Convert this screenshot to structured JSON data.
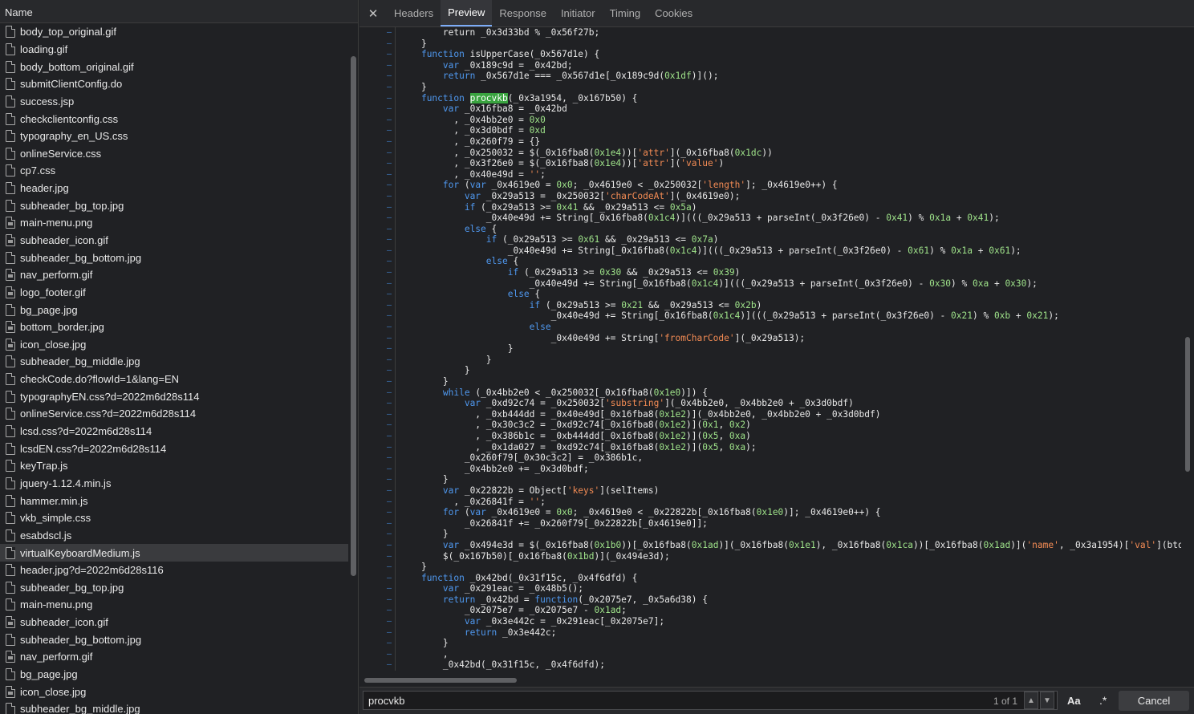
{
  "left_panel": {
    "header": "Name",
    "files": [
      {
        "name": "body_top_original.gif",
        "icon": "file-icon"
      },
      {
        "name": "loading.gif",
        "icon": "file-icon"
      },
      {
        "name": "body_bottom_original.gif",
        "icon": "file-icon"
      },
      {
        "name": "submitClientConfig.do",
        "icon": "file-icon"
      },
      {
        "name": "success.jsp",
        "icon": "file-icon"
      },
      {
        "name": "checkclientconfig.css",
        "icon": "file-icon"
      },
      {
        "name": "typography_en_US.css",
        "icon": "file-icon"
      },
      {
        "name": "onlineService.css",
        "icon": "file-icon"
      },
      {
        "name": "cp7.css",
        "icon": "file-icon"
      },
      {
        "name": "header.jpg",
        "icon": "file-icon"
      },
      {
        "name": "subheader_bg_top.jpg",
        "icon": "file-icon"
      },
      {
        "name": "main-menu.png",
        "icon": "image-icon"
      },
      {
        "name": "subheader_icon.gif",
        "icon": "image-icon"
      },
      {
        "name": "subheader_bg_bottom.jpg",
        "icon": "file-icon"
      },
      {
        "name": "nav_perform.gif",
        "icon": "image-icon"
      },
      {
        "name": "logo_footer.gif",
        "icon": "image-icon"
      },
      {
        "name": "bg_page.jpg",
        "icon": "file-icon"
      },
      {
        "name": "bottom_border.jpg",
        "icon": "image-icon"
      },
      {
        "name": "icon_close.jpg",
        "icon": "image-icon"
      },
      {
        "name": "subheader_bg_middle.jpg",
        "icon": "file-icon"
      },
      {
        "name": "checkCode.do?flowId=1&lang=EN",
        "icon": "file-icon"
      },
      {
        "name": "typographyEN.css?d=2022m6d28s114",
        "icon": "file-icon"
      },
      {
        "name": "onlineService.css?d=2022m6d28s114",
        "icon": "file-icon"
      },
      {
        "name": "lcsd.css?d=2022m6d28s114",
        "icon": "file-icon"
      },
      {
        "name": "lcsdEN.css?d=2022m6d28s114",
        "icon": "file-icon"
      },
      {
        "name": "keyTrap.js",
        "icon": "file-icon"
      },
      {
        "name": "jquery-1.12.4.min.js",
        "icon": "file-icon"
      },
      {
        "name": "hammer.min.js",
        "icon": "file-icon"
      },
      {
        "name": "vkb_simple.css",
        "icon": "file-icon"
      },
      {
        "name": "esabdscl.js",
        "icon": "file-icon"
      },
      {
        "name": "virtualKeyboardMedium.js",
        "icon": "file-icon",
        "selected": true
      },
      {
        "name": "header.jpg?d=2022m6d28s116",
        "icon": "file-icon"
      },
      {
        "name": "subheader_bg_top.jpg",
        "icon": "file-icon"
      },
      {
        "name": "main-menu.png",
        "icon": "file-icon"
      },
      {
        "name": "subheader_icon.gif",
        "icon": "image-icon"
      },
      {
        "name": "subheader_bg_bottom.jpg",
        "icon": "file-icon"
      },
      {
        "name": "nav_perform.gif",
        "icon": "image-icon"
      },
      {
        "name": "bg_page.jpg",
        "icon": "file-icon"
      },
      {
        "name": "icon_close.jpg",
        "icon": "image-icon"
      },
      {
        "name": "subheader_bg_middle.jpg",
        "icon": "file-icon"
      }
    ]
  },
  "tabs": [
    "Headers",
    "Preview",
    "Response",
    "Initiator",
    "Timing",
    "Cookies"
  ],
  "active_tab": "Preview",
  "code_lines": [
    [
      {
        "t": "        return _0x3d33bd % _0x56f27b;"
      }
    ],
    [
      {
        "t": "    }"
      }
    ],
    [
      {
        "t": "    "
      },
      {
        "t": "function",
        "c": "k"
      },
      {
        "t": " isUpperCase(_0x567d1e) {"
      }
    ],
    [
      {
        "t": "        "
      },
      {
        "t": "var",
        "c": "k"
      },
      {
        "t": " _0x189c9d = _0x42bd;"
      }
    ],
    [
      {
        "t": "        "
      },
      {
        "t": "return",
        "c": "k"
      },
      {
        "t": " _0x567d1e === _0x567d1e[_0x189c9d("
      },
      {
        "t": "0x1df",
        "c": "n"
      },
      {
        "t": ")]();"
      }
    ],
    [
      {
        "t": "    }"
      }
    ],
    [
      {
        "t": "    "
      },
      {
        "t": "function",
        "c": "k"
      },
      {
        "t": " "
      },
      {
        "t": "procvkb",
        "c": "hl"
      },
      {
        "t": "(_0x3a1954, _0x167b50) {"
      }
    ],
    [
      {
        "t": "        "
      },
      {
        "t": "var",
        "c": "k"
      },
      {
        "t": " _0x16fba8 = _0x42bd"
      }
    ],
    [
      {
        "t": "          , _0x4bb2e0 = "
      },
      {
        "t": "0x0",
        "c": "n"
      }
    ],
    [
      {
        "t": "          , _0x3d0bdf = "
      },
      {
        "t": "0xd",
        "c": "n"
      }
    ],
    [
      {
        "t": "          , _0x260f79 = {}"
      }
    ],
    [
      {
        "t": "          , _0x250032 = $(_0x16fba8("
      },
      {
        "t": "0x1e4",
        "c": "n"
      },
      {
        "t": "))["
      },
      {
        "t": "'attr'",
        "c": "s"
      },
      {
        "t": "](_0x16fba8("
      },
      {
        "t": "0x1dc",
        "c": "n"
      },
      {
        "t": "))"
      }
    ],
    [
      {
        "t": "          , _0x3f26e0 = $(_0x16fba8("
      },
      {
        "t": "0x1e4",
        "c": "n"
      },
      {
        "t": "))["
      },
      {
        "t": "'attr'",
        "c": "s"
      },
      {
        "t": "]("
      },
      {
        "t": "'value'",
        "c": "s"
      },
      {
        "t": ")"
      }
    ],
    [
      {
        "t": "          , _0x40e49d = "
      },
      {
        "t": "''",
        "c": "s"
      },
      {
        "t": ";"
      }
    ],
    [
      {
        "t": "        "
      },
      {
        "t": "for",
        "c": "k"
      },
      {
        "t": " ("
      },
      {
        "t": "var",
        "c": "k"
      },
      {
        "t": " _0x4619e0 = "
      },
      {
        "t": "0x0",
        "c": "n"
      },
      {
        "t": "; _0x4619e0 < _0x250032["
      },
      {
        "t": "'length'",
        "c": "s"
      },
      {
        "t": "]; _0x4619e0++) {"
      }
    ],
    [
      {
        "t": "            "
      },
      {
        "t": "var",
        "c": "k"
      },
      {
        "t": " _0x29a513 = _0x250032["
      },
      {
        "t": "'charCodeAt'",
        "c": "s"
      },
      {
        "t": "](_0x4619e0);"
      }
    ],
    [
      {
        "t": "            "
      },
      {
        "t": "if",
        "c": "k"
      },
      {
        "t": " (_0x29a513 >= "
      },
      {
        "t": "0x41",
        "c": "n"
      },
      {
        "t": " && _0x29a513 <= "
      },
      {
        "t": "0x5a",
        "c": "n"
      },
      {
        "t": ")"
      }
    ],
    [
      {
        "t": "                _0x40e49d += String[_0x16fba8("
      },
      {
        "t": "0x1c4",
        "c": "n"
      },
      {
        "t": ")](((_0x29a513 + parseInt(_0x3f26e0) - "
      },
      {
        "t": "0x41",
        "c": "n"
      },
      {
        "t": ") % "
      },
      {
        "t": "0x1a",
        "c": "n"
      },
      {
        "t": " + "
      },
      {
        "t": "0x41",
        "c": "n"
      },
      {
        "t": ");"
      }
    ],
    [
      {
        "t": "            "
      },
      {
        "t": "else",
        "c": "k"
      },
      {
        "t": " {"
      }
    ],
    [
      {
        "t": "                "
      },
      {
        "t": "if",
        "c": "k"
      },
      {
        "t": " (_0x29a513 >= "
      },
      {
        "t": "0x61",
        "c": "n"
      },
      {
        "t": " && _0x29a513 <= "
      },
      {
        "t": "0x7a",
        "c": "n"
      },
      {
        "t": ")"
      }
    ],
    [
      {
        "t": "                    _0x40e49d += String[_0x16fba8("
      },
      {
        "t": "0x1c4",
        "c": "n"
      },
      {
        "t": ")](((_0x29a513 + parseInt(_0x3f26e0) - "
      },
      {
        "t": "0x61",
        "c": "n"
      },
      {
        "t": ") % "
      },
      {
        "t": "0x1a",
        "c": "n"
      },
      {
        "t": " + "
      },
      {
        "t": "0x61",
        "c": "n"
      },
      {
        "t": ");"
      }
    ],
    [
      {
        "t": "                "
      },
      {
        "t": "else",
        "c": "k"
      },
      {
        "t": " {"
      }
    ],
    [
      {
        "t": "                    "
      },
      {
        "t": "if",
        "c": "k"
      },
      {
        "t": " (_0x29a513 >= "
      },
      {
        "t": "0x30",
        "c": "n"
      },
      {
        "t": " && _0x29a513 <= "
      },
      {
        "t": "0x39",
        "c": "n"
      },
      {
        "t": ")"
      }
    ],
    [
      {
        "t": "                        _0x40e49d += String[_0x16fba8("
      },
      {
        "t": "0x1c4",
        "c": "n"
      },
      {
        "t": ")](((_0x29a513 + parseInt(_0x3f26e0) - "
      },
      {
        "t": "0x30",
        "c": "n"
      },
      {
        "t": ") % "
      },
      {
        "t": "0xa",
        "c": "n"
      },
      {
        "t": " + "
      },
      {
        "t": "0x30",
        "c": "n"
      },
      {
        "t": ");"
      }
    ],
    [
      {
        "t": "                    "
      },
      {
        "t": "else",
        "c": "k"
      },
      {
        "t": " {"
      }
    ],
    [
      {
        "t": "                        "
      },
      {
        "t": "if",
        "c": "k"
      },
      {
        "t": " (_0x29a513 >= "
      },
      {
        "t": "0x21",
        "c": "n"
      },
      {
        "t": " && _0x29a513 <= "
      },
      {
        "t": "0x2b",
        "c": "n"
      },
      {
        "t": ")"
      }
    ],
    [
      {
        "t": "                            _0x40e49d += String[_0x16fba8("
      },
      {
        "t": "0x1c4",
        "c": "n"
      },
      {
        "t": ")](((_0x29a513 + parseInt(_0x3f26e0) - "
      },
      {
        "t": "0x21",
        "c": "n"
      },
      {
        "t": ") % "
      },
      {
        "t": "0xb",
        "c": "n"
      },
      {
        "t": " + "
      },
      {
        "t": "0x21",
        "c": "n"
      },
      {
        "t": ");"
      }
    ],
    [
      {
        "t": "                        "
      },
      {
        "t": "else",
        "c": "k"
      }
    ],
    [
      {
        "t": "                            _0x40e49d += String["
      },
      {
        "t": "'fromCharCode'",
        "c": "s"
      },
      {
        "t": "](_0x29a513);"
      }
    ],
    [
      {
        "t": "                    }"
      }
    ],
    [
      {
        "t": "                }"
      }
    ],
    [
      {
        "t": "            }"
      }
    ],
    [
      {
        "t": "        }"
      }
    ],
    [
      {
        "t": "        "
      },
      {
        "t": "while",
        "c": "k"
      },
      {
        "t": " (_0x4bb2e0 < _0x250032[_0x16fba8("
      },
      {
        "t": "0x1e0",
        "c": "n"
      },
      {
        "t": ")]) {"
      }
    ],
    [
      {
        "t": "            "
      },
      {
        "t": "var",
        "c": "k"
      },
      {
        "t": " _0xd92c74 = _0x250032["
      },
      {
        "t": "'substring'",
        "c": "s"
      },
      {
        "t": "](_0x4bb2e0, _0x4bb2e0 + _0x3d0bdf)"
      }
    ],
    [
      {
        "t": "              , _0xb444dd = _0x40e49d[_0x16fba8("
      },
      {
        "t": "0x1e2",
        "c": "n"
      },
      {
        "t": ")](_0x4bb2e0, _0x4bb2e0 + _0x3d0bdf)"
      }
    ],
    [
      {
        "t": "              , _0x30c3c2 = _0xd92c74[_0x16fba8("
      },
      {
        "t": "0x1e2",
        "c": "n"
      },
      {
        "t": ")]("
      },
      {
        "t": "0x1",
        "c": "n"
      },
      {
        "t": ", "
      },
      {
        "t": "0x2",
        "c": "n"
      },
      {
        "t": ")"
      }
    ],
    [
      {
        "t": "              , _0x386b1c = _0xb444dd[_0x16fba8("
      },
      {
        "t": "0x1e2",
        "c": "n"
      },
      {
        "t": ")]("
      },
      {
        "t": "0x5",
        "c": "n"
      },
      {
        "t": ", "
      },
      {
        "t": "0xa",
        "c": "n"
      },
      {
        "t": ")"
      }
    ],
    [
      {
        "t": "              , _0x1da027 = _0xd92c74[_0x16fba8("
      },
      {
        "t": "0x1e2",
        "c": "n"
      },
      {
        "t": ")]("
      },
      {
        "t": "0x5",
        "c": "n"
      },
      {
        "t": ", "
      },
      {
        "t": "0xa",
        "c": "n"
      },
      {
        "t": ");"
      }
    ],
    [
      {
        "t": "            _0x260f79[_0x30c3c2] = _0x386b1c,"
      }
    ],
    [
      {
        "t": "            _0x4bb2e0 += _0x3d0bdf;"
      }
    ],
    [
      {
        "t": "        }"
      }
    ],
    [
      {
        "t": "        "
      },
      {
        "t": "var",
        "c": "k"
      },
      {
        "t": " _0x22822b = Object["
      },
      {
        "t": "'keys'",
        "c": "s"
      },
      {
        "t": "](selItems)"
      }
    ],
    [
      {
        "t": "          , _0x26841f = "
      },
      {
        "t": "''",
        "c": "s"
      },
      {
        "t": ";"
      }
    ],
    [
      {
        "t": "        "
      },
      {
        "t": "for",
        "c": "k"
      },
      {
        "t": " ("
      },
      {
        "t": "var",
        "c": "k"
      },
      {
        "t": " _0x4619e0 = "
      },
      {
        "t": "0x0",
        "c": "n"
      },
      {
        "t": "; _0x4619e0 < _0x22822b[_0x16fba8("
      },
      {
        "t": "0x1e0",
        "c": "n"
      },
      {
        "t": ")]; _0x4619e0++) {"
      }
    ],
    [
      {
        "t": "            _0x26841f += _0x260f79[_0x22822b[_0x4619e0]];"
      }
    ],
    [
      {
        "t": "        }"
      }
    ],
    [
      {
        "t": "        "
      },
      {
        "t": "var",
        "c": "k"
      },
      {
        "t": " _0x494e3d = $(_0x16fba8("
      },
      {
        "t": "0x1b0",
        "c": "n"
      },
      {
        "t": "))[_0x16fba8("
      },
      {
        "t": "0x1ad",
        "c": "n"
      },
      {
        "t": ")](_0x16fba8("
      },
      {
        "t": "0x1e1",
        "c": "n"
      },
      {
        "t": "), _0x16fba8("
      },
      {
        "t": "0x1ca",
        "c": "n"
      },
      {
        "t": "))[_0x16fba8("
      },
      {
        "t": "0x1ad",
        "c": "n"
      },
      {
        "t": ")]("
      },
      {
        "t": "'name'",
        "c": "s"
      },
      {
        "t": ", _0x3a1954)["
      },
      {
        "t": "'val'",
        "c": "s"
      },
      {
        "t": "](btoa("
      }
    ],
    [
      {
        "t": "        $(_0x167b50)[_0x16fba8("
      },
      {
        "t": "0x1bd",
        "c": "n"
      },
      {
        "t": ")](_0x494e3d);"
      }
    ],
    [
      {
        "t": "    }"
      }
    ],
    [
      {
        "t": "    "
      },
      {
        "t": "function",
        "c": "k"
      },
      {
        "t": " _0x42bd(_0x31f15c, _0x4f6dfd) {"
      }
    ],
    [
      {
        "t": "        "
      },
      {
        "t": "var",
        "c": "k"
      },
      {
        "t": " _0x291eac = _0x48b5();"
      }
    ],
    [
      {
        "t": "        "
      },
      {
        "t": "return",
        "c": "k"
      },
      {
        "t": " _0x42bd = "
      },
      {
        "t": "function",
        "c": "k"
      },
      {
        "t": "(_0x2075e7, _0x5a6d38) {"
      }
    ],
    [
      {
        "t": "            _0x2075e7 = _0x2075e7 - "
      },
      {
        "t": "0x1ad",
        "c": "n"
      },
      {
        "t": ";"
      }
    ],
    [
      {
        "t": "            "
      },
      {
        "t": "var",
        "c": "k"
      },
      {
        "t": " _0x3e442c = _0x291eac[_0x2075e7];"
      }
    ],
    [
      {
        "t": "            "
      },
      {
        "t": "return",
        "c": "k"
      },
      {
        "t": " _0x3e442c;"
      }
    ],
    [
      {
        "t": "        }"
      }
    ],
    [
      {
        "t": "        ,"
      }
    ],
    [
      {
        "t": "        _0x42bd(_0x31f15c, _0x4f6dfd);"
      }
    ]
  ],
  "search": {
    "value": "procvkb",
    "match_count": "1 of 1",
    "case_label": "Aa",
    "regex_label": ".*",
    "cancel_label": "Cancel"
  },
  "icons": {
    "close": "close-icon",
    "up": "chevron-up-icon",
    "down": "chevron-down-icon"
  }
}
